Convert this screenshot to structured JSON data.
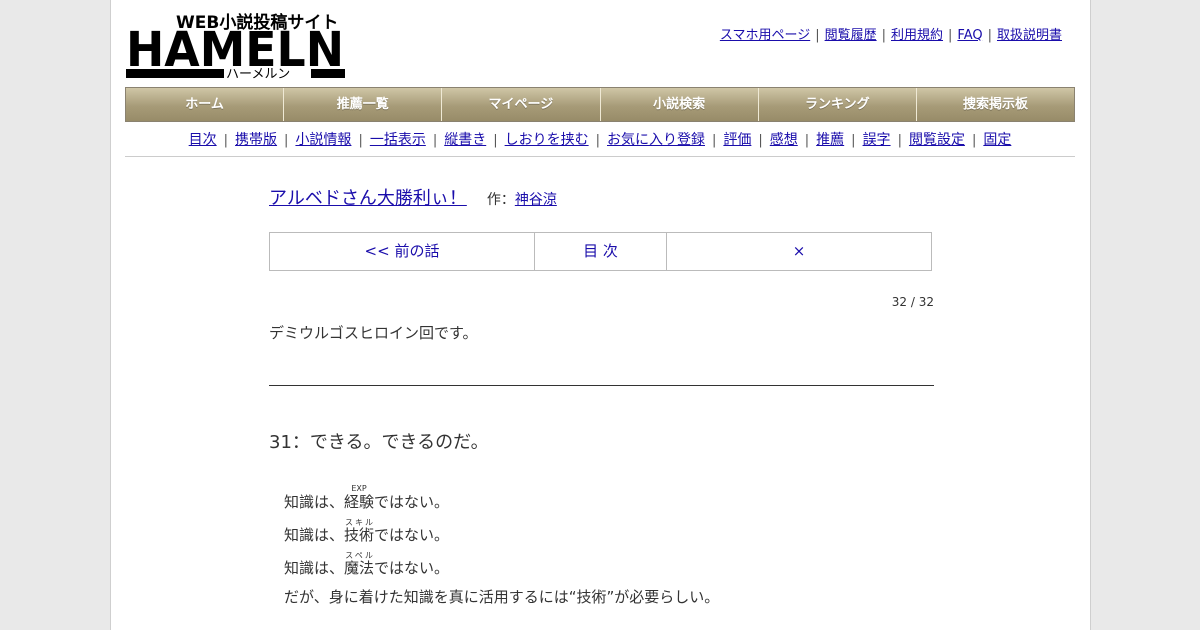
{
  "header": {
    "logo_tagline": "WEB小説投稿サイト",
    "logo_main": "HAMELN",
    "logo_reading": "ハーメルン",
    "top_links": [
      {
        "label": "スマホ用ページ"
      },
      {
        "label": "閲覧履歴"
      },
      {
        "label": "利用規約"
      },
      {
        "label": "FAQ"
      },
      {
        "label": "取扱説明書"
      }
    ]
  },
  "nav": {
    "items": [
      "ホーム",
      "推薦一覧",
      "マイページ",
      "小説検索",
      "ランキング",
      "捜索掲示板"
    ]
  },
  "subnav": {
    "items": [
      "目次",
      "携帯版",
      "小説情報",
      "一括表示",
      "縦書き",
      "しおりを挟む",
      "お気に入り登録",
      "評価",
      "感想",
      "推薦",
      "誤字",
      "閲覧設定",
      "固定"
    ]
  },
  "novel": {
    "title": "アルベドさん大勝利ぃ！",
    "author_prefix": "作：",
    "author": "神谷涼"
  },
  "pager": {
    "prev": "<< 前の話",
    "toc": "目 次",
    "next": "×"
  },
  "counter": "32 / 32",
  "preface": "デミウルゴスヒロイン回です。",
  "chapter": {
    "title": "31：できる。できるのだ。",
    "lines": [
      {
        "pre": "知識は、",
        "ruby_base": "経験",
        "ruby_text": "EXP",
        "post": "ではない。"
      },
      {
        "pre": "知識は、",
        "ruby_base": "技術",
        "ruby_text": "スキル",
        "post": "ではない。"
      },
      {
        "pre": "知識は、",
        "ruby_base": "魔法",
        "ruby_text": "スペル",
        "post": "ではない。"
      }
    ],
    "last_line": "だが、身に着けた知識を真に活用するには“技術”が必要らしい。"
  },
  "colors": {
    "nav_gradient_top": "#cfc6a6",
    "nav_gradient_bottom": "#988c68",
    "link": "#1a0dab",
    "page_background": "#e9e9e9"
  }
}
